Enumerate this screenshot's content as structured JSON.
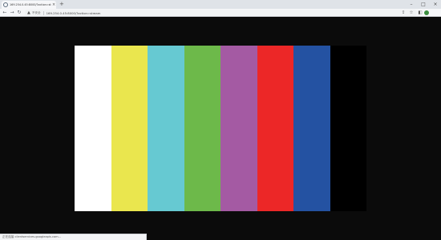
{
  "tab": {
    "title": "169.254.0.45:8000/?action=stream",
    "close": "×"
  },
  "new_tab": "+",
  "window_controls": [
    "–",
    "□",
    "×"
  ],
  "toolbar": {
    "back": "←",
    "forward": "→",
    "reload": "↻",
    "security_warning": "▲",
    "security_label": "不安全",
    "url": "169.254.0.45:8000/?action=stream",
    "share": "⇪",
    "bookmark": "☆",
    "sidebar": "◧"
  },
  "test_pattern": {
    "colors": [
      "#ffffff",
      "#eae64e",
      "#66c9d2",
      "#6db94a",
      "#a45aa3",
      "#ec2727",
      "#2452a2",
      "#000000"
    ]
  },
  "status": {
    "text": "正在连接 clientservices.googleapis.com..."
  }
}
